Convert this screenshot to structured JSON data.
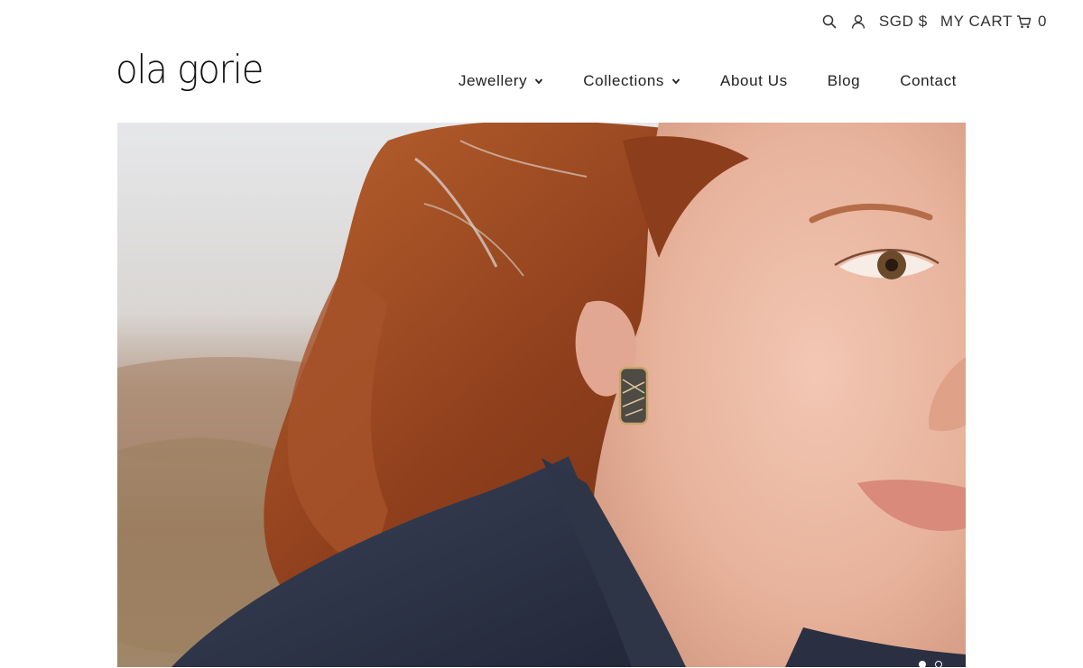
{
  "header": {
    "logo_text": "ola gorie",
    "currency": "SGD $",
    "cart_label": "MY CART",
    "cart_count": "0",
    "icons": [
      "search-icon",
      "account-icon",
      "cart-icon"
    ]
  },
  "nav": {
    "items": [
      {
        "label": "Jewellery",
        "has_dropdown": true
      },
      {
        "label": "Collections",
        "has_dropdown": true
      },
      {
        "label": "About Us",
        "has_dropdown": false
      },
      {
        "label": "Blog",
        "has_dropdown": false
      },
      {
        "label": "Contact",
        "has_dropdown": false
      }
    ]
  },
  "hero": {
    "image_subject": "woman with red hair wearing a patterned earring",
    "slides": 2,
    "active_slide": 1
  },
  "colors": {
    "text": "#1a1a1a",
    "background": "#ffffff",
    "hair": "#9a4a22",
    "skin": "#e9b8a3",
    "jacket": "#2b3244"
  }
}
